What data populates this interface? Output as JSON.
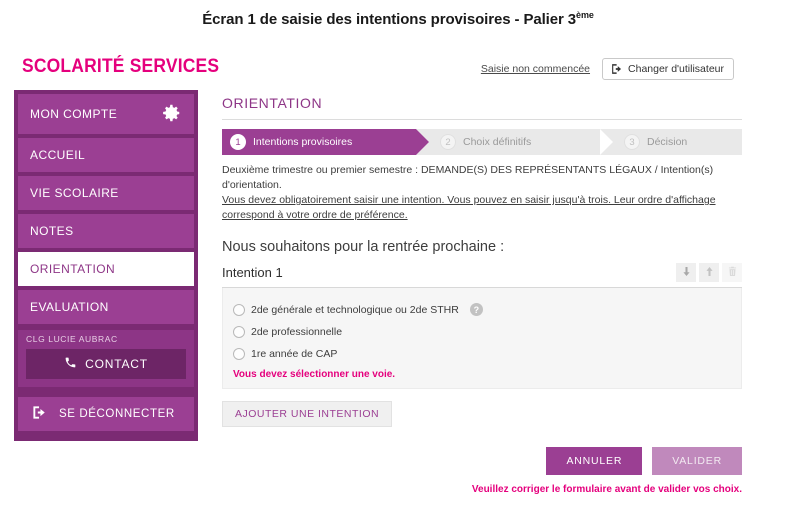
{
  "page": {
    "title_main": "Écran 1 de saisie des intentions provisoires - Palier 3",
    "title_sup": "ème"
  },
  "header": {
    "brand": "SCOLARITÉ SERVICES",
    "status_label": "Saisie non commencée",
    "switch_user_label": "Changer d'utilisateur"
  },
  "sidebar": {
    "account_label": "MON COMPTE",
    "items": [
      {
        "label": "ACCUEIL",
        "active": false
      },
      {
        "label": "VIE SCOLAIRE",
        "active": false
      },
      {
        "label": "NOTES",
        "active": false
      },
      {
        "label": "ORIENTATION",
        "active": true
      },
      {
        "label": "EVALUATION",
        "active": false
      }
    ],
    "school_name": "CLG LUCIE AUBRAC",
    "contact_label": "CONTACT",
    "logout_label": "SE DÉCONNECTER"
  },
  "main": {
    "section_title": "ORIENTATION",
    "steps": [
      {
        "number": "1",
        "label": "Intentions provisoires",
        "state": "current"
      },
      {
        "number": "2",
        "label": "Choix définitifs",
        "state": "todo"
      },
      {
        "number": "3",
        "label": "Décision",
        "state": "todo"
      }
    ],
    "intro_line1": "Deuxième trimestre ou premier semestre : DEMANDE(S) DES REPRÉSENTANTS LÉGAUX / Intention(s) d'orientation.",
    "intro_line2": "Vous devez obligatoirement saisir une intention. Vous pouvez en saisir jusqu'à trois. Leur ordre d'affichage correspond à votre ordre de préférence.",
    "lead": "Nous souhaitons pour la rentrée prochaine :",
    "intention": {
      "title": "Intention 1",
      "options": [
        {
          "label": "2de générale et technologique ou 2de STHR",
          "selected": false,
          "help": "?"
        },
        {
          "label": "2de professionnelle",
          "selected": false
        },
        {
          "label": "1re année de CAP",
          "selected": false
        }
      ],
      "error": "Vous devez sélectionner une voie."
    },
    "add_intention_label": "AJOUTER UNE INTENTION",
    "cancel_label": "ANNULER",
    "validate_label": "VALIDER",
    "form_error": "Veuillez corriger le formulaire avant de valider vos choix."
  },
  "colors": {
    "brand_pink": "#e5007d",
    "purple": "#9b3f93",
    "purple_dark": "#7b2a73",
    "purple_deep": "#6d2566",
    "validate_disabled": "#c089bc",
    "step_inactive_bg": "#e9e9e9"
  }
}
